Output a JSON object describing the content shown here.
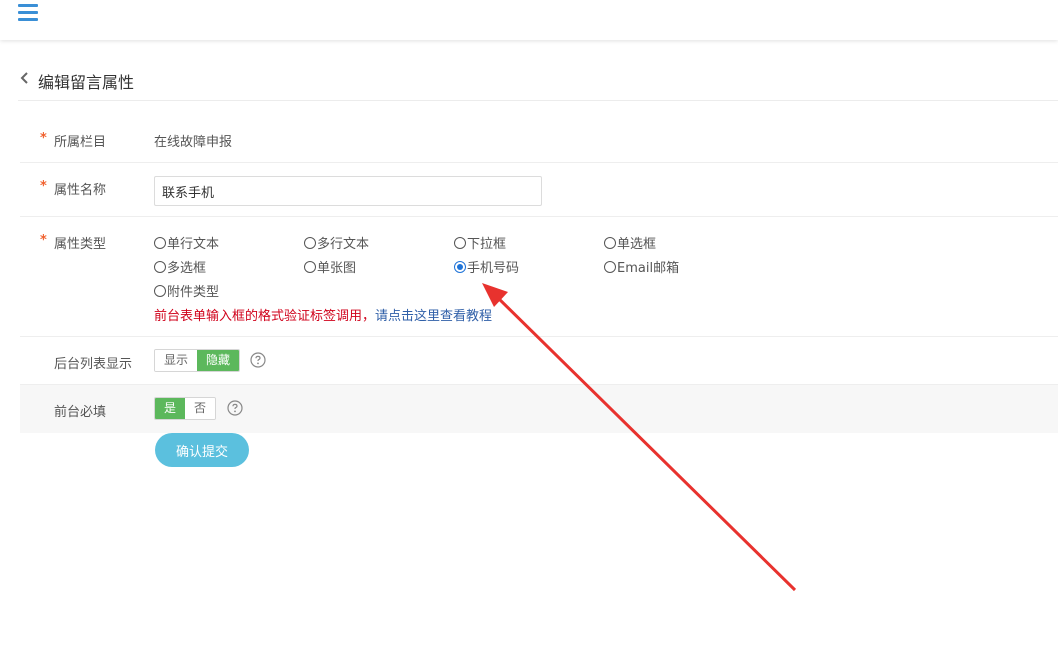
{
  "header": {
    "title": "编辑留言属性"
  },
  "form": {
    "column": {
      "label": "所属栏目",
      "required_mark": "*",
      "value": "在线故障申报"
    },
    "name": {
      "label": "属性名称",
      "required_mark": "*",
      "value": "联系手机"
    },
    "type": {
      "label": "属性类型",
      "required_mark": "*",
      "options": [
        "单行文本",
        "多行文本",
        "下拉框",
        "单选框",
        "多选框",
        "单张图",
        "手机号码",
        "Email邮箱",
        "附件类型"
      ],
      "selected": "手机号码",
      "hint_text": "前台表单输入框的格式验证标签调用，",
      "hint_link": "请点击这里查看教程"
    },
    "list_display": {
      "label": "后台列表显示",
      "options": [
        "显示",
        "隐藏"
      ],
      "selected": "隐藏"
    },
    "required_front": {
      "label": "前台必填",
      "options": [
        "是",
        "否"
      ],
      "selected": "是"
    },
    "submit_label": "确认提交"
  },
  "colors": {
    "accent_blue": "#3a8fd6",
    "required_star": "#f0612f",
    "hint_red": "#d0021b",
    "toggle_green": "#5cb85c",
    "submit_cyan": "#5bc0de",
    "annotation_arrow": "#e8322e"
  },
  "icons": [
    "menu-icon",
    "chevron-left-icon",
    "help-circle-icon"
  ]
}
